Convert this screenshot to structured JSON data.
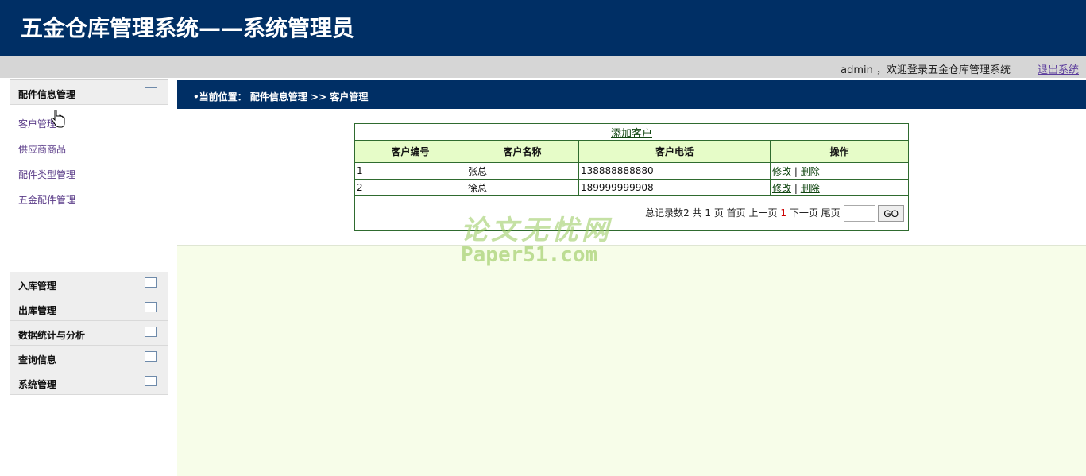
{
  "header": {
    "title": "五金仓库管理系统——系统管理员"
  },
  "userbar": {
    "welcome": "admin ，欢迎登录五金仓库管理系统",
    "logout": "退出系统"
  },
  "sidebar": {
    "groups": [
      {
        "label": "配件信息管理",
        "expanded": true,
        "items": [
          "客户管理",
          "供应商商品",
          "配件类型管理",
          "五金配件管理"
        ]
      },
      {
        "label": "入库管理",
        "expanded": false
      },
      {
        "label": "出库管理",
        "expanded": false
      },
      {
        "label": "数据统计与分析",
        "expanded": false
      },
      {
        "label": "查询信息",
        "expanded": false
      },
      {
        "label": "系统管理",
        "expanded": false
      }
    ]
  },
  "breadcrumb": {
    "text": "•当前位置： 配件信息管理 >> 客户管理"
  },
  "table": {
    "add_link": "添加客户",
    "headers": [
      "客户编号",
      "客户名称",
      "客户电话",
      "操作"
    ],
    "rows": [
      {
        "id": "1",
        "name": "张总",
        "phone": "138888888880",
        "edit": "修改",
        "sep": "|",
        "delete": "删除"
      },
      {
        "id": "2",
        "name": "徐总",
        "phone": "189999999908",
        "edit": "修改",
        "sep": "|",
        "delete": "删除"
      }
    ]
  },
  "pager": {
    "total_label": "总记录数2 共 1 页",
    "first": "首页",
    "prev": "上一页",
    "current": "1",
    "next": "下一页",
    "last": "尾页",
    "go": "GO"
  },
  "watermark": {
    "line1": "论文无忧网",
    "line2": "Paper51.com"
  },
  "colors": {
    "header_bg": "#002f65",
    "content_bg": "#f7fde9",
    "table_header_bg": "#e6fcc8",
    "link": "#114611"
  }
}
